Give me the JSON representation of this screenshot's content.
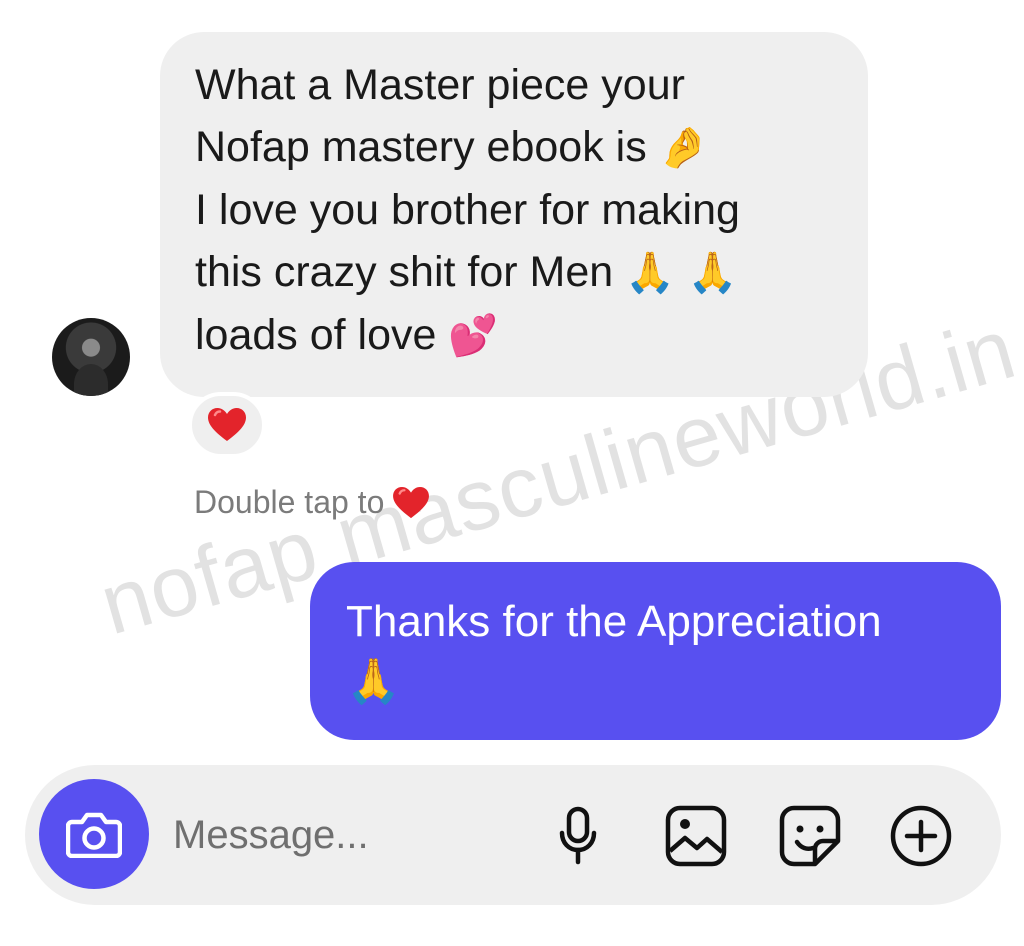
{
  "conversation": {
    "received_message": {
      "lines": [
        {
          "text": "What a Master piece your",
          "emoji": ""
        },
        {
          "text": "Nofap mastery ebook is",
          "emoji": "🤌"
        },
        {
          "text": "I love you brother for making",
          "emoji": ""
        },
        {
          "text": "this crazy shit for Men",
          "emoji": "🙏 🙏"
        },
        {
          "text": "loads of love",
          "emoji": "💕"
        }
      ],
      "reaction": "❤️"
    },
    "hint": {
      "text": "Double tap to"
    },
    "sent_message": {
      "line1": "Thanks for the Appreciation",
      "line2": "🙏"
    }
  },
  "watermark": {
    "text": "nofap masculineworld.in"
  },
  "composer": {
    "placeholder": "Message...",
    "icons": [
      "camera-icon",
      "microphone-icon",
      "gallery-icon",
      "sticker-icon",
      "plus-circle-icon"
    ]
  },
  "colors": {
    "accent": "#5850f0",
    "bubble_received": "#efefef",
    "reaction_heart": "#e3242b"
  }
}
